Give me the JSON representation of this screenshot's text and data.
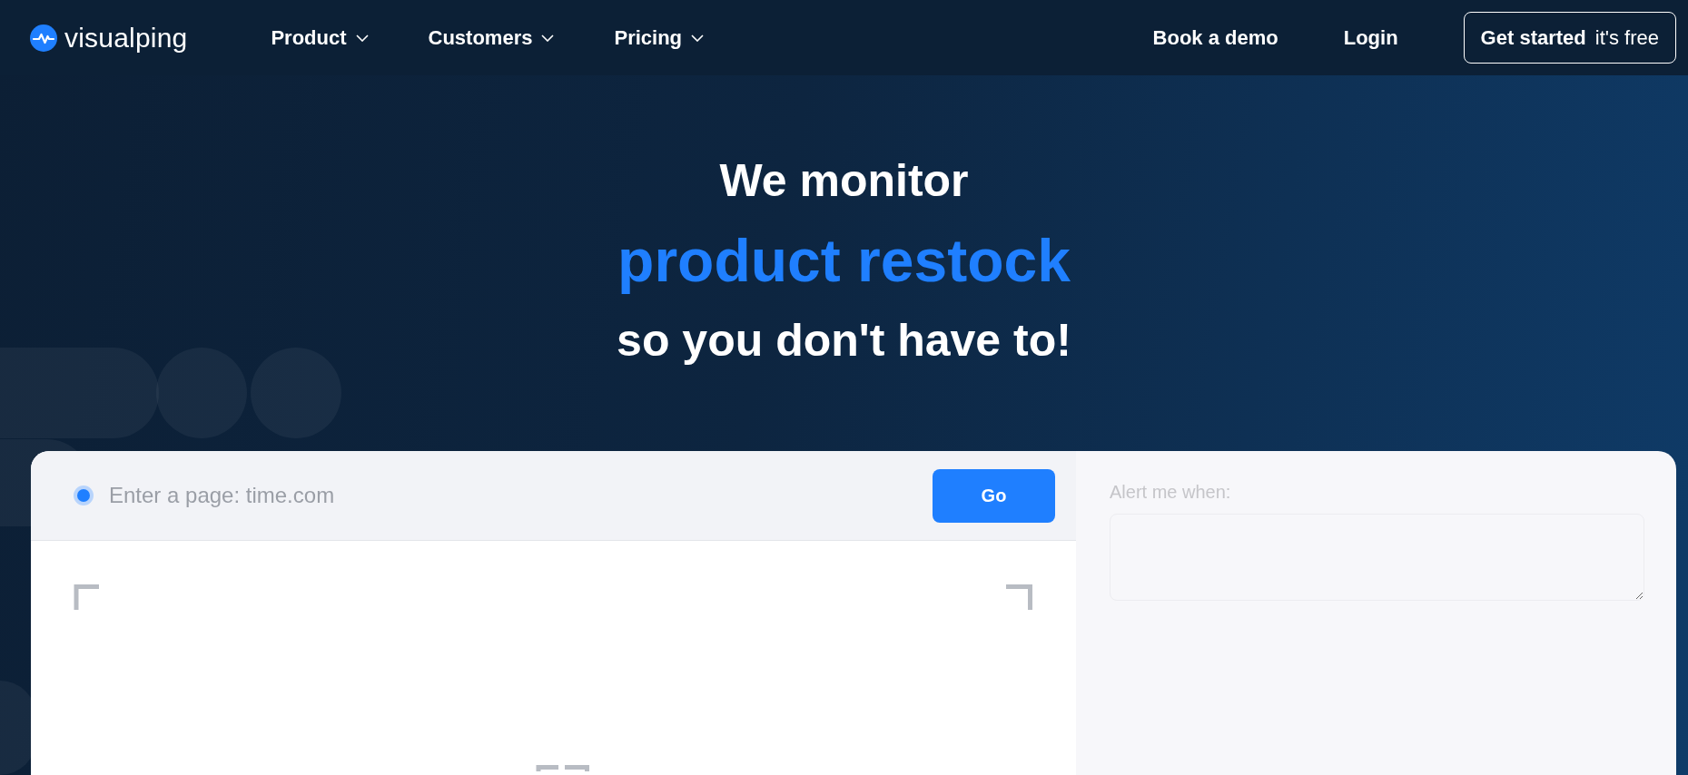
{
  "header": {
    "logo": "visualping",
    "nav": [
      {
        "label": "Product"
      },
      {
        "label": "Customers"
      },
      {
        "label": "Pricing"
      }
    ],
    "links": [
      "Book a demo",
      "Login"
    ],
    "cta": "**Get started** it's free"
  },
  "hero": {
    "lines": [
      {
        "text": "We monitor",
        "kind": "plain"
      },
      {
        "text": "product restock",
        "kind": "accent"
      },
      {
        "text": "so you don't have to!",
        "kind": "plain"
      }
    ]
  },
  "card": {
    "url_field": {
      "placeholder": "Enter a page: time.com"
    },
    "go_button": "Go",
    "alert_label": "Alert me when:"
  }
}
